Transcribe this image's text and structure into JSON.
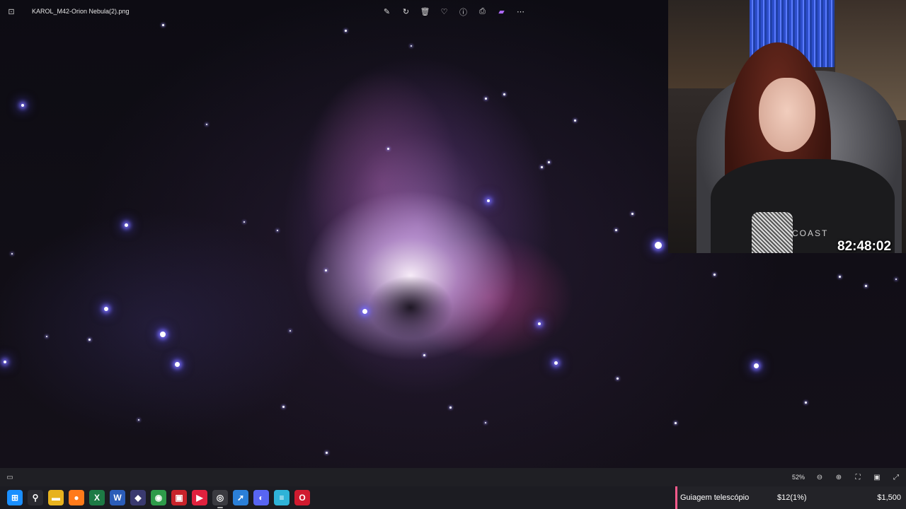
{
  "viewer": {
    "file_name": "KAROL_M42-Orion Nebula(2).png",
    "zoom_level": "52%",
    "toolbar_icons": [
      "edit-icon",
      "rotate-icon",
      "delete-icon",
      "favorite-icon",
      "info-icon",
      "print-icon",
      "editor-app-icon",
      "more-icon"
    ],
    "bottom_icons": [
      "zoom-out-icon",
      "zoom-in-icon",
      "fit-to-window-icon",
      "actual-size-icon",
      "fullscreen-icon"
    ]
  },
  "stream": {
    "timer": "82:48:02",
    "shirt_text": "COAST",
    "goal": {
      "name": "Guiagem telescópio",
      "current": "$12(1%)",
      "target": "$1,500",
      "accent": "#ff5a8c"
    }
  },
  "taskbar": {
    "icons": [
      {
        "name": "windows-start-icon",
        "glyph": "⊞",
        "color": "#1a8fff"
      },
      {
        "name": "search-icon",
        "glyph": "⚲",
        "color": "#2a2a30"
      },
      {
        "name": "file-explorer-icon",
        "glyph": "▬",
        "color": "#e7b21e"
      },
      {
        "name": "firefox-icon",
        "glyph": "●",
        "color": "#ff7a1a"
      },
      {
        "name": "excel-icon",
        "glyph": "X",
        "color": "#1d7a45"
      },
      {
        "name": "word-icon",
        "glyph": "W",
        "color": "#2b5db8"
      },
      {
        "name": "app-diamond-icon",
        "glyph": "◆",
        "color": "#3a3a70"
      },
      {
        "name": "chrome-icon",
        "glyph": "◉",
        "color": "#2e9b4a"
      },
      {
        "name": "app-red-badge-icon",
        "glyph": "▣",
        "color": "#c8232b"
      },
      {
        "name": "media-player-icon",
        "glyph": "▶",
        "color": "#e0213e"
      },
      {
        "name": "obs-icon",
        "glyph": "◎",
        "color": "#3a3a40"
      },
      {
        "name": "app-blue-arrow-icon",
        "glyph": "➚",
        "color": "#2b7fd8"
      },
      {
        "name": "discord-icon",
        "glyph": "◐",
        "color": "#5865f2"
      },
      {
        "name": "notepad-icon",
        "glyph": "≡",
        "color": "#2fb3d8"
      },
      {
        "name": "opera-icon",
        "glyph": "O",
        "color": "#d01a2f"
      }
    ]
  }
}
